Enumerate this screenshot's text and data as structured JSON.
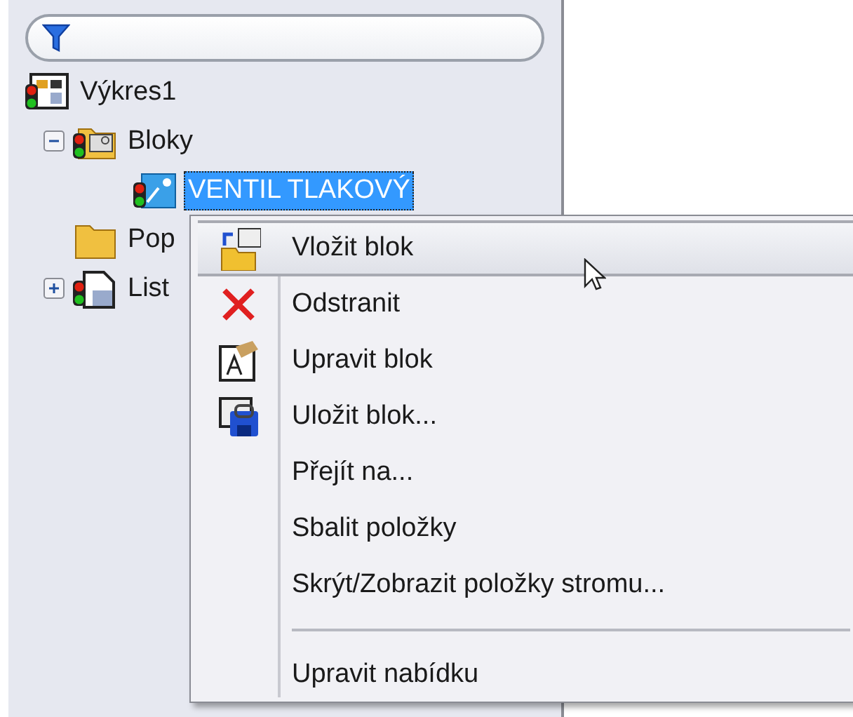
{
  "tree": [
    {
      "label": "Výkres1",
      "selected": false,
      "children": [
        {
          "label": "Bloky",
          "selected": false,
          "expanded": true,
          "children": [
            {
              "label": "VENTIL TLAKOVÝ",
              "selected": true
            }
          ]
        },
        {
          "label": "Pop",
          "selected": false
        },
        {
          "label": "List",
          "selected": false,
          "expanded": false
        }
      ]
    }
  ],
  "context_menu": [
    {
      "kind": "item",
      "label": "Vložit blok",
      "highlighted": true
    },
    {
      "kind": "item",
      "label": "Odstranit",
      "highlighted": false
    },
    {
      "kind": "item",
      "label": "Upravit blok",
      "highlighted": false
    },
    {
      "kind": "item",
      "label": "Uložit blok...",
      "highlighted": false
    },
    {
      "kind": "item",
      "label": "Přejít na...",
      "highlighted": false
    },
    {
      "kind": "item",
      "label": "Sbalit položky",
      "highlighted": false
    },
    {
      "kind": "item",
      "label": "Skrýt/Zobrazit položky stromu...",
      "highlighted": false
    },
    {
      "kind": "separator"
    },
    {
      "kind": "item",
      "label": "Upravit nabídku",
      "highlighted": false
    }
  ]
}
